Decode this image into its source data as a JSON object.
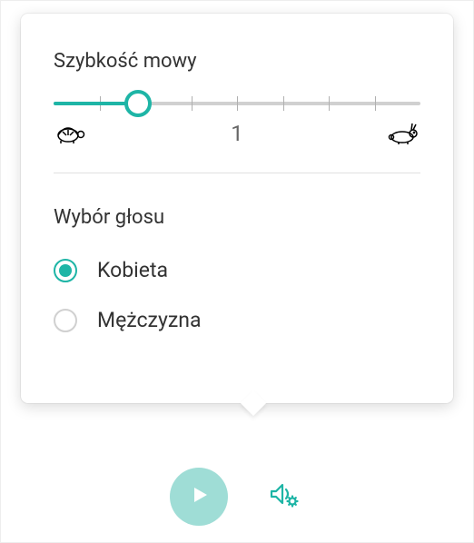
{
  "speed": {
    "title": "Szybkość mowy",
    "centerLabel": "1",
    "valuePercent": 23
  },
  "voice": {
    "title": "Wybór głosu",
    "options": [
      {
        "label": "Kobieta",
        "selected": true
      },
      {
        "label": "Mężczyzna",
        "selected": false
      }
    ]
  },
  "icons": {
    "turtle": "turtle-icon",
    "rabbit": "rabbit-icon",
    "play": "play-icon",
    "audioSettings": "audio-settings-icon"
  },
  "colors": {
    "accent": "#1eb5a6",
    "accentLight": "#9fddd6"
  }
}
